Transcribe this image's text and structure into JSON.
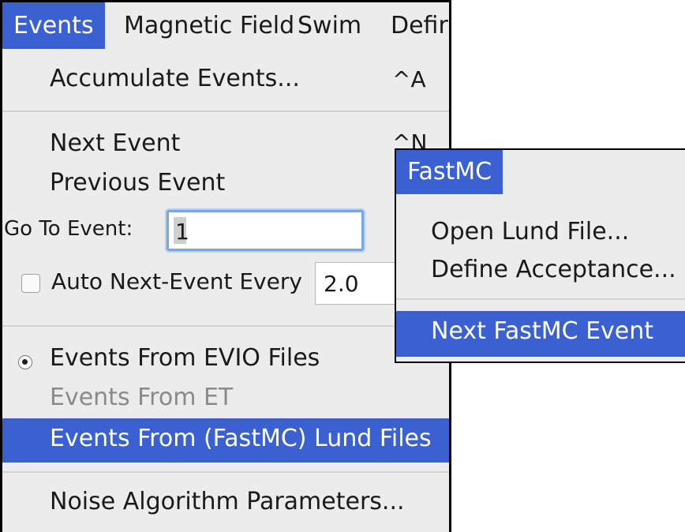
{
  "menubar": {
    "items": [
      "Events",
      "Magnetic Field",
      "Swim",
      "Defir"
    ]
  },
  "events_menu": {
    "accumulate": {
      "label": "Accumulate Events...",
      "shortcut": "^A"
    },
    "next_event": {
      "label": "Next Event",
      "shortcut": "^N"
    },
    "previous_event": {
      "label": "Previous Event"
    },
    "goto": {
      "label": "Go To Event:",
      "value": "1"
    },
    "auto_next": {
      "label": "Auto Next-Event Every",
      "value": "2.0",
      "checked": false
    },
    "source_evio": {
      "label": "Events From EVIO Files",
      "selected": true
    },
    "source_et": {
      "label": "Events From ET",
      "enabled": false
    },
    "source_lund": {
      "label": "Events From (FastMC) Lund Files"
    },
    "noise": {
      "label": "Noise Algorithm Parameters..."
    }
  },
  "fastmc_menu": {
    "title": "FastMC",
    "items": [
      "Open Lund File...",
      "Define Acceptance...",
      "Next FastMC Event"
    ]
  },
  "colors": {
    "menu_bg": "#ececec",
    "highlight": "#3a60d2",
    "disabled_text": "#8a8a8a"
  }
}
